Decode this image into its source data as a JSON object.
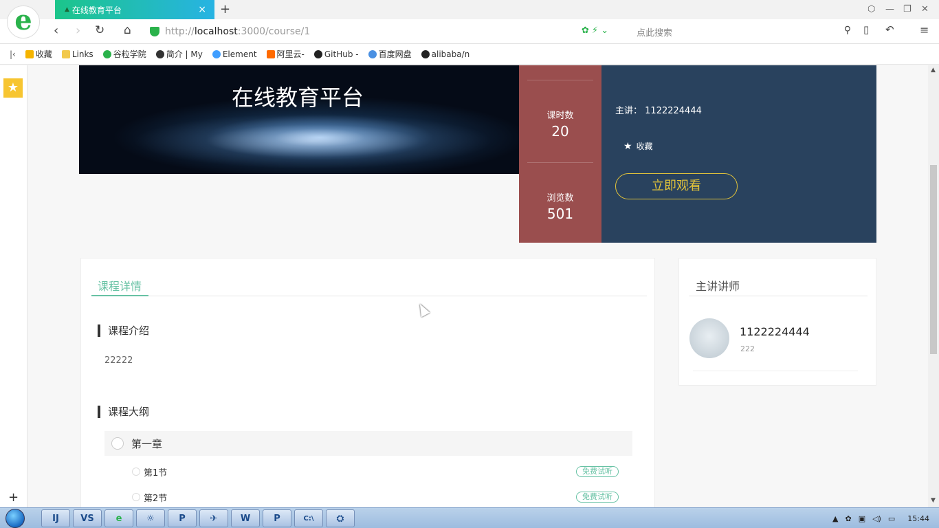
{
  "browser": {
    "tab_title": "在线教育平台",
    "url_prefix": "http://",
    "url_host": "localhost",
    "url_rest": ":3000/course/1",
    "search_placeholder": "点此搜索"
  },
  "bookmarks": [
    {
      "label": "收藏",
      "color": "#f5b400"
    },
    {
      "label": "Links",
      "color": "#f2c94c"
    },
    {
      "label": "谷粒学院",
      "color": "#2ab24b"
    },
    {
      "label": "简介 | My",
      "color": "#333333"
    },
    {
      "label": "Element",
      "color": "#409eff"
    },
    {
      "label": "阿里云-",
      "color": "#ff6a00"
    },
    {
      "label": "GitHub -",
      "color": "#222222"
    },
    {
      "label": "百度网盘",
      "color": "#4a90e2"
    },
    {
      "label": "alibaba/n",
      "color": "#222222"
    }
  ],
  "course": {
    "banner_title": "在线教育平台",
    "lessons_label": "课时数",
    "lessons_count": "20",
    "views_label": "浏览数",
    "views_count": "501",
    "teacher_label": "主讲：",
    "teacher_name": "1122224444",
    "favorite_label": "收藏",
    "watch_button": "立即观看"
  },
  "detail": {
    "tab_label": "课程详情",
    "intro_title": "课程介绍",
    "intro_text": "22222",
    "outline_title": "课程大纲",
    "chapter_title": "第一章",
    "lessons": [
      {
        "title": "第1节",
        "badge": "免费试听"
      },
      {
        "title": "第2节",
        "badge": "免费试听"
      }
    ]
  },
  "teacher_card": {
    "heading": "主讲讲师",
    "name": "1122224444",
    "intro": "222"
  },
  "taskbar": {
    "apps": [
      "IJ",
      "VS",
      "e",
      "☼",
      "P",
      "✈",
      "W",
      "P",
      "C:\\",
      "⛭"
    ],
    "time": "15:44"
  },
  "colors": {
    "accent": "#67c2a4",
    "stats_bg": "#9a4e4e",
    "info_bg": "#29425e",
    "watch_button": "#e3c43a"
  }
}
